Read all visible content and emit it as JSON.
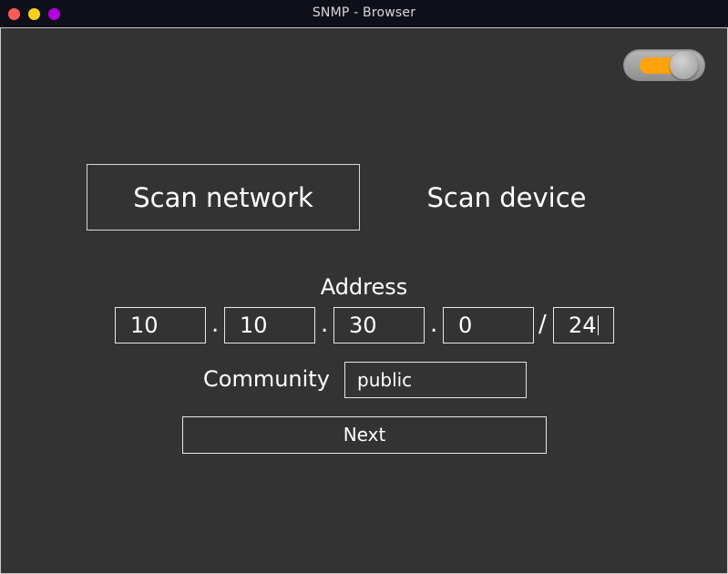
{
  "window": {
    "title": "SNMP - Browser"
  },
  "toggle": {
    "state": "on",
    "accent_color": "#ffa20c"
  },
  "modes": {
    "scan_network": "Scan network",
    "scan_device": "Scan device",
    "active": "scan_network"
  },
  "address": {
    "label": "Address",
    "octet1": "10",
    "octet2": "10",
    "octet3": "30",
    "octet4": "0",
    "dot": ".",
    "slash": "/",
    "prefix": "24"
  },
  "community": {
    "label": "Community",
    "value": "public"
  },
  "next": {
    "label": "Next"
  },
  "colors": {
    "background": "#333333",
    "titlebar": "#0e0f18",
    "border": "#e6e6e6"
  }
}
